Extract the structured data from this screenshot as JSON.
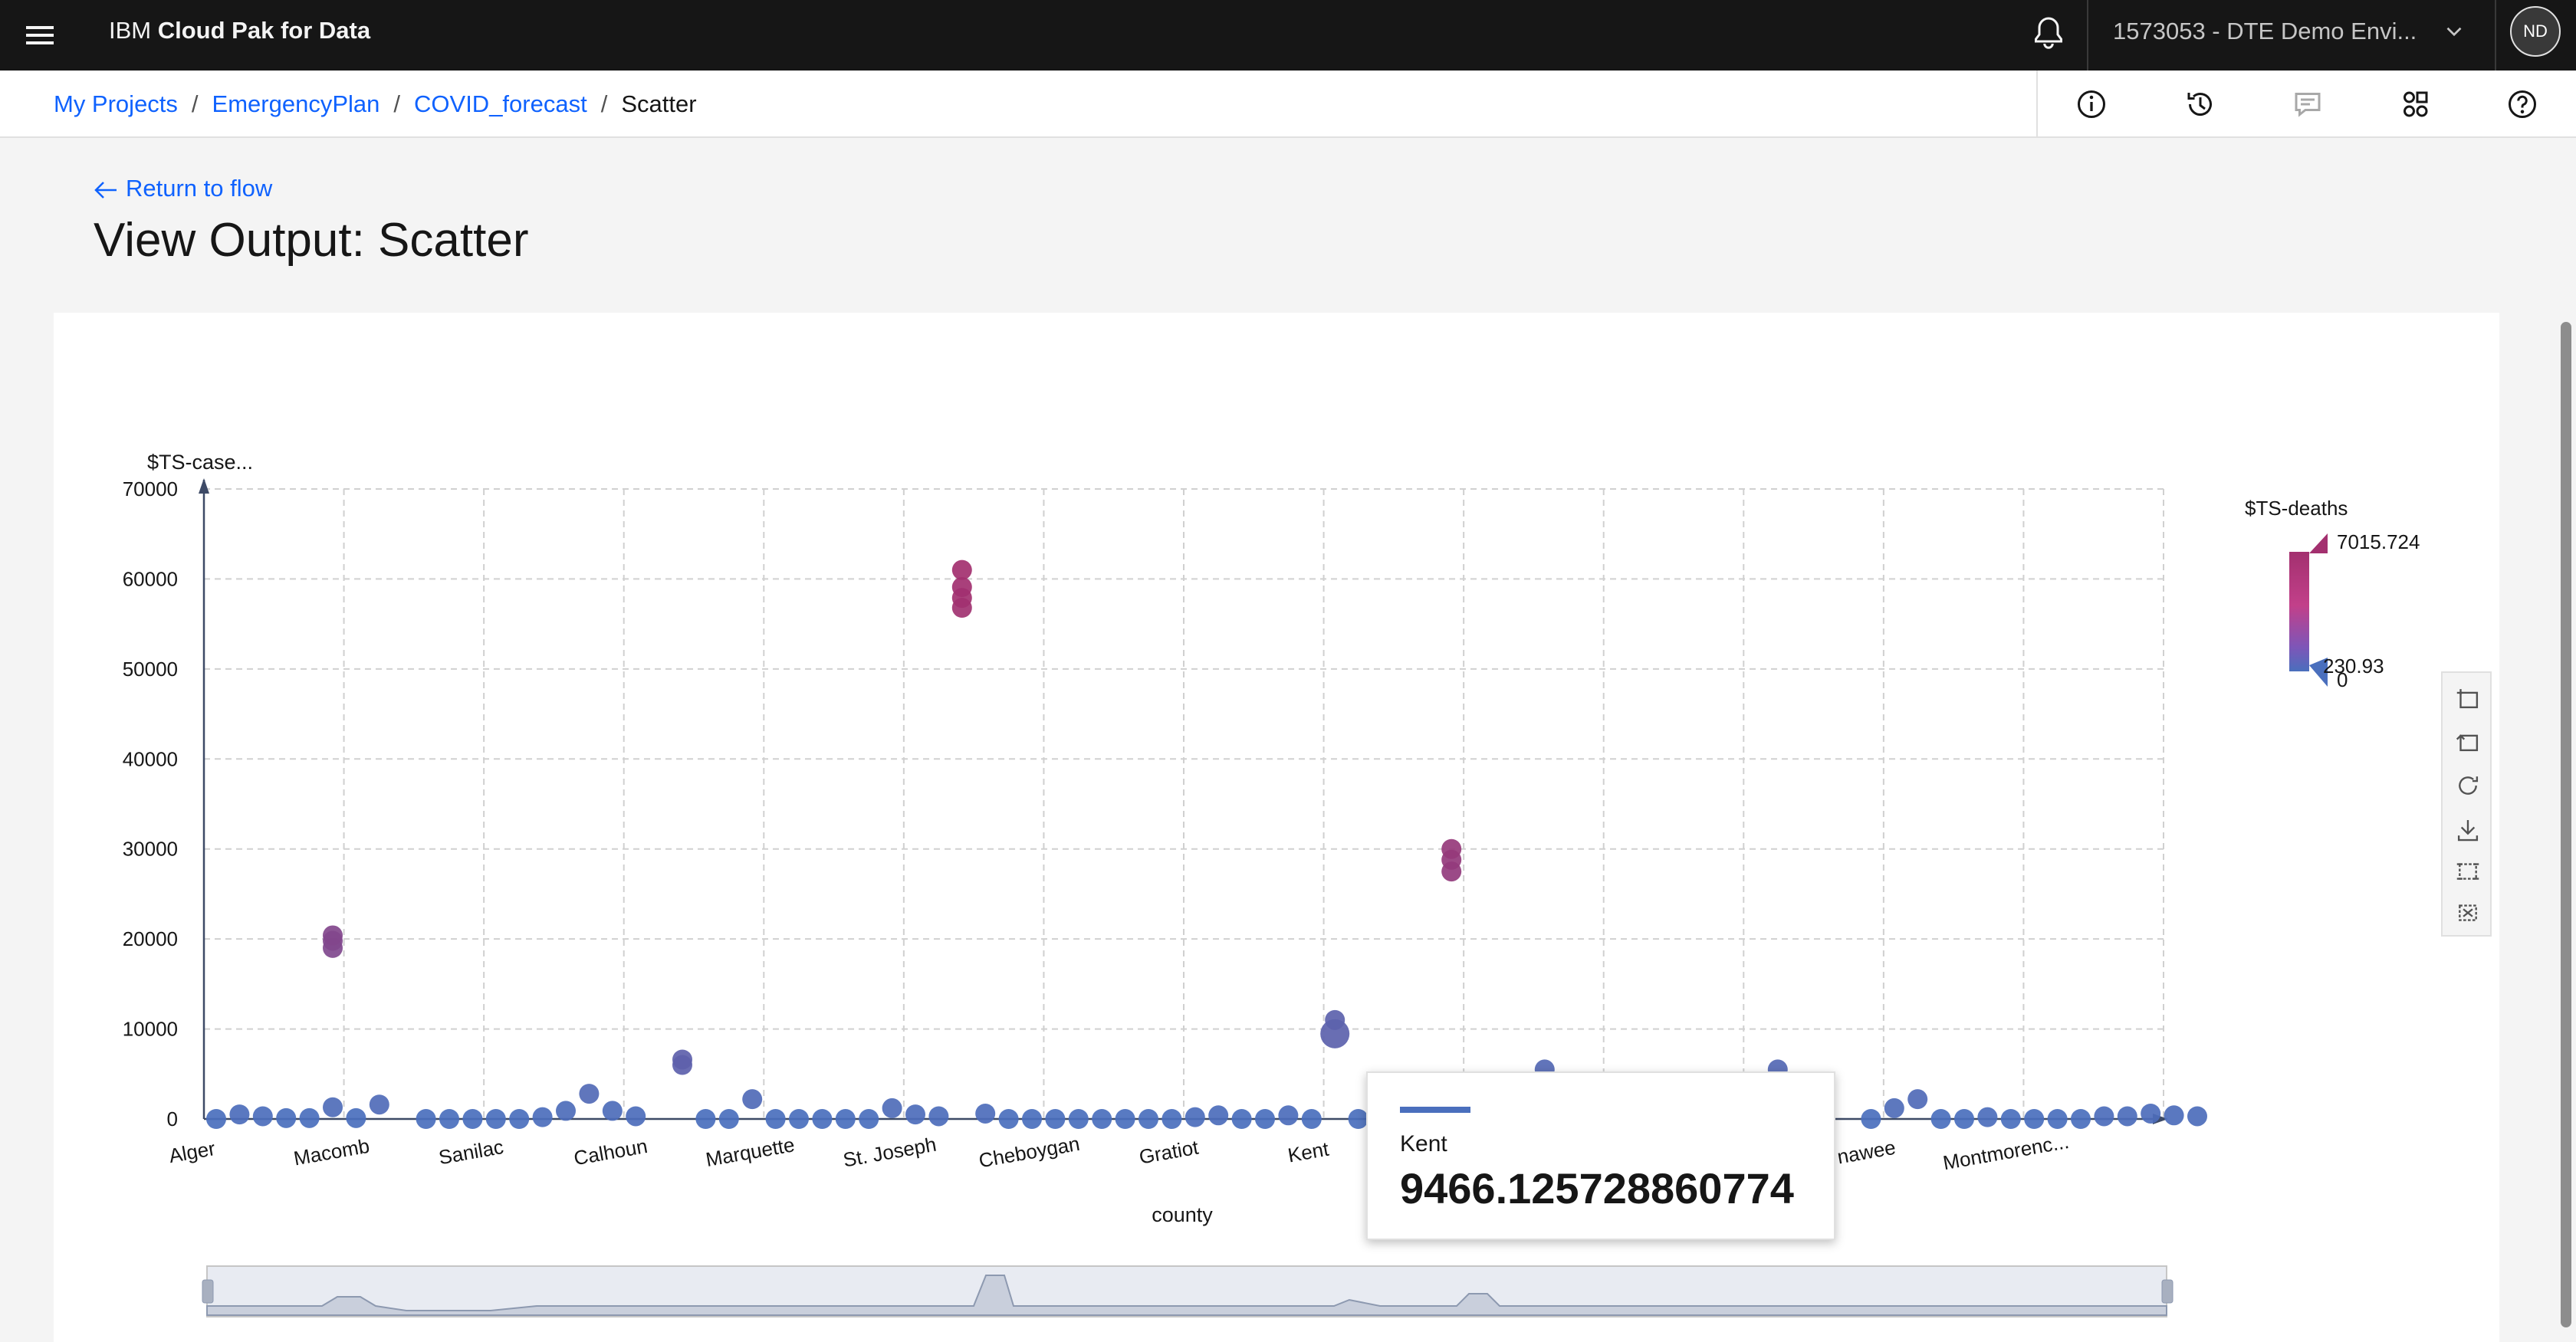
{
  "header": {
    "brand_prefix": "IBM",
    "brand_name": "Cloud Pak for Data",
    "environment": "1573053 - DTE Demo Envi...",
    "avatar_initials": "ND"
  },
  "breadcrumb": {
    "items": [
      "My Projects",
      "EmergencyPlan",
      "COVID_forecast"
    ],
    "current": "Scatter"
  },
  "toolbar_icons": [
    "info-icon",
    "history-icon",
    "comment-icon",
    "settings-adjust-icon",
    "help-icon"
  ],
  "page": {
    "back_link": "Return to flow",
    "title": "View Output: Scatter"
  },
  "chart_data": {
    "type": "scatter",
    "xlabel": "county",
    "ylabel": "$TS-case...",
    "ylim": [
      0,
      70000
    ],
    "yticks": [
      0,
      10000,
      20000,
      30000,
      40000,
      50000,
      60000,
      70000
    ],
    "x_tick_labels": [
      "Alger",
      "Macomb",
      "Sanilac",
      "Calhoun",
      "Marquette",
      "St. Joseph",
      "Cheboygan",
      "Gratiot",
      "Kent",
      "",
      "",
      "",
      "nawee",
      "Montmorenc..."
    ],
    "grid": true,
    "legend_position": "right",
    "color_legend": {
      "title": "$TS-deaths",
      "max": "7015.724",
      "mid": "230.93",
      "min": "0",
      "low_color": "#4a6fbd",
      "high_color": "#a3306f"
    },
    "points": [
      {
        "x": 0,
        "y": 0,
        "c": 0
      },
      {
        "x": 1,
        "y": 500,
        "c": 2
      },
      {
        "x": 2,
        "y": 300,
        "c": 1
      },
      {
        "x": 3,
        "y": 100,
        "c": 0
      },
      {
        "x": 4,
        "y": 100,
        "c": 0
      },
      {
        "x": 5,
        "y": 1300,
        "c": 10
      },
      {
        "x": 5,
        "y": 19000,
        "c": 2300
      },
      {
        "x": 5,
        "y": 19800,
        "c": 2400
      },
      {
        "x": 5,
        "y": 20400,
        "c": 2500
      },
      {
        "x": 6,
        "y": 100,
        "c": 0
      },
      {
        "x": 7,
        "y": 1600,
        "c": 15
      },
      {
        "x": 9,
        "y": 0,
        "c": 0
      },
      {
        "x": 10,
        "y": 0,
        "c": 0
      },
      {
        "x": 11,
        "y": 0,
        "c": 0
      },
      {
        "x": 12,
        "y": 0,
        "c": 0
      },
      {
        "x": 13,
        "y": 0,
        "c": 0
      },
      {
        "x": 14,
        "y": 200,
        "c": 1
      },
      {
        "x": 15,
        "y": 900,
        "c": 5
      },
      {
        "x": 16,
        "y": 2800,
        "c": 30
      },
      {
        "x": 17,
        "y": 900,
        "c": 5
      },
      {
        "x": 18,
        "y": 300,
        "c": 2
      },
      {
        "x": 20,
        "y": 6000,
        "c": 240
      },
      {
        "x": 20,
        "y": 6600,
        "c": 260
      },
      {
        "x": 21,
        "y": 0,
        "c": 0
      },
      {
        "x": 22,
        "y": 0,
        "c": 0
      },
      {
        "x": 23,
        "y": 2200,
        "c": 20
      },
      {
        "x": 24,
        "y": 0,
        "c": 0
      },
      {
        "x": 25,
        "y": 0,
        "c": 0
      },
      {
        "x": 26,
        "y": 0,
        "c": 0
      },
      {
        "x": 27,
        "y": 0,
        "c": 0
      },
      {
        "x": 28,
        "y": 0,
        "c": 0
      },
      {
        "x": 29,
        "y": 1200,
        "c": 10
      },
      {
        "x": 30,
        "y": 500,
        "c": 3
      },
      {
        "x": 31,
        "y": 300,
        "c": 2
      },
      {
        "x": 32,
        "y": 56800,
        "c": 6600
      },
      {
        "x": 32,
        "y": 57900,
        "c": 6800
      },
      {
        "x": 32,
        "y": 59100,
        "c": 6900
      },
      {
        "x": 32,
        "y": 61000,
        "c": 7015
      },
      {
        "x": 33,
        "y": 600,
        "c": 3
      },
      {
        "x": 34,
        "y": 0,
        "c": 0
      },
      {
        "x": 35,
        "y": 0,
        "c": 0
      },
      {
        "x": 36,
        "y": 0,
        "c": 0
      },
      {
        "x": 37,
        "y": 0,
        "c": 0
      },
      {
        "x": 38,
        "y": 0,
        "c": 0
      },
      {
        "x": 39,
        "y": 0,
        "c": 0
      },
      {
        "x": 40,
        "y": 0,
        "c": 0
      },
      {
        "x": 41,
        "y": 0,
        "c": 0
      },
      {
        "x": 42,
        "y": 200,
        "c": 1
      },
      {
        "x": 43,
        "y": 400,
        "c": 2
      },
      {
        "x": 44,
        "y": 0,
        "c": 0
      },
      {
        "x": 45,
        "y": 0,
        "c": 0
      },
      {
        "x": 46,
        "y": 400,
        "c": 2
      },
      {
        "x": 47,
        "y": 0,
        "c": 0
      },
      {
        "x": 48,
        "y": 9466.125728860774,
        "c": 200
      },
      {
        "x": 48,
        "y": 11000,
        "c": 210
      },
      {
        "x": 49,
        "y": 0,
        "c": 0
      },
      {
        "x": 53,
        "y": 27500,
        "c": 4500
      },
      {
        "x": 53,
        "y": 28800,
        "c": 4700
      },
      {
        "x": 53,
        "y": 30000,
        "c": 4900
      },
      {
        "x": 57,
        "y": 5500,
        "c": 60
      },
      {
        "x": 67,
        "y": 5500,
        "c": 60
      },
      {
        "x": 71,
        "y": 0,
        "c": 0
      },
      {
        "x": 72,
        "y": 1200,
        "c": 10
      },
      {
        "x": 73,
        "y": 2200,
        "c": 20
      },
      {
        "x": 74,
        "y": 0,
        "c": 0
      },
      {
        "x": 75,
        "y": 0,
        "c": 0
      },
      {
        "x": 76,
        "y": 200,
        "c": 1
      },
      {
        "x": 77,
        "y": 0,
        "c": 0
      },
      {
        "x": 78,
        "y": 0,
        "c": 0
      },
      {
        "x": 79,
        "y": 0,
        "c": 0
      },
      {
        "x": 80,
        "y": 0,
        "c": 0
      },
      {
        "x": 81,
        "y": 300,
        "c": 2
      },
      {
        "x": 82,
        "y": 300,
        "c": 2
      },
      {
        "x": 83,
        "y": 600,
        "c": 3
      },
      {
        "x": 84,
        "y": 400,
        "c": 2
      },
      {
        "x": 85,
        "y": 300,
        "c": 2
      }
    ]
  },
  "tooltip": {
    "label": "Kent",
    "value": "9466.125728860774"
  },
  "chart_toolbox": [
    "zoom-area-icon",
    "zoom-reset-icon",
    "restore-icon",
    "download-icon",
    "select-area-icon",
    "clear-selection-icon"
  ],
  "colors": {
    "accent": "#0f62fe",
    "header_bg": "#161616",
    "point_low": "#4a6fbd",
    "point_high": "#a3306f"
  }
}
